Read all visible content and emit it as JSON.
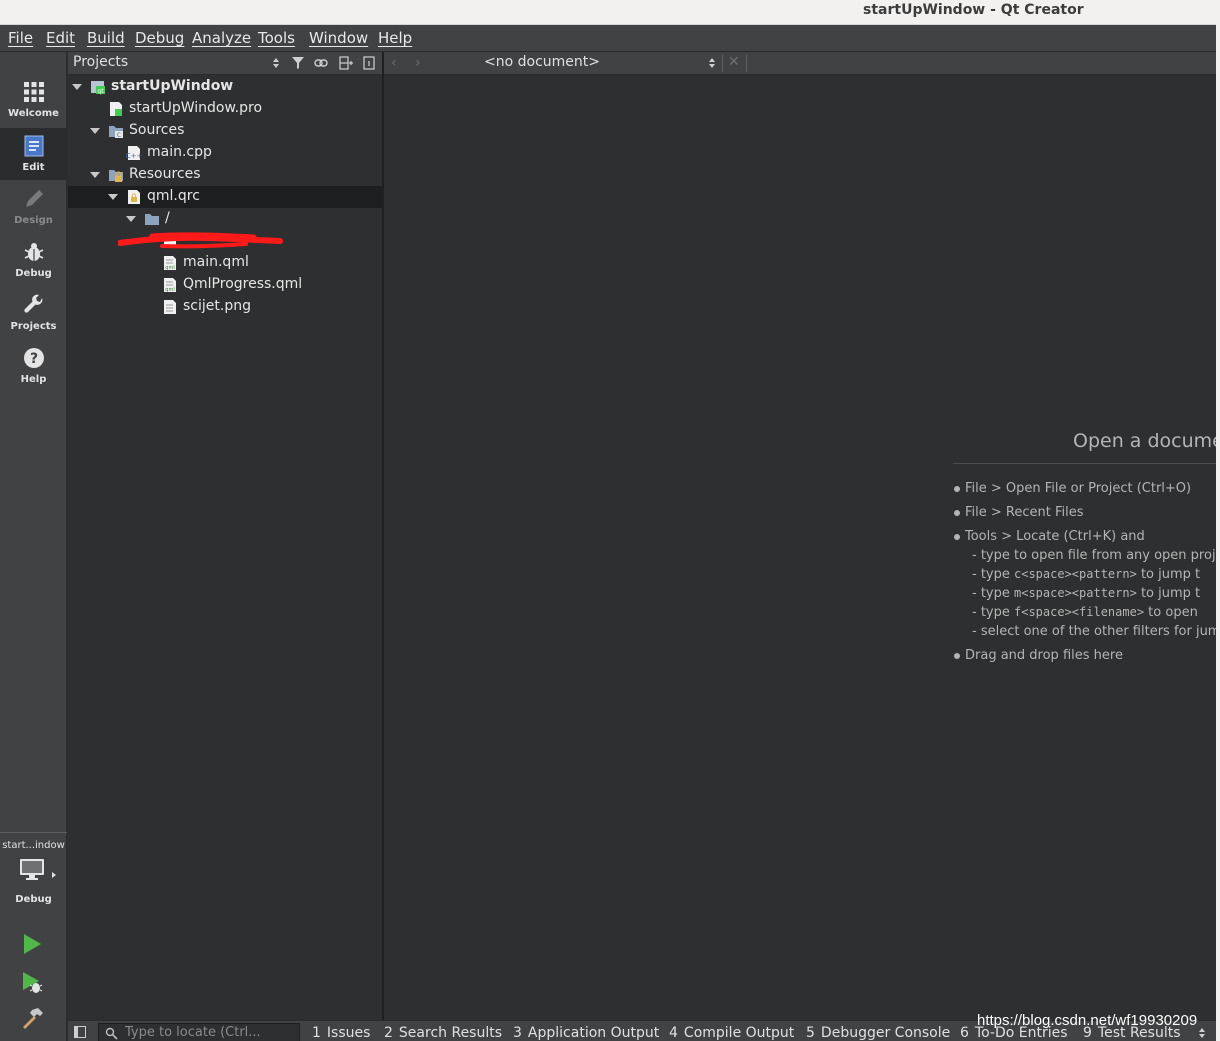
{
  "window": {
    "title": "startUpWindow - Qt Creator"
  },
  "menu": [
    "File",
    "Edit",
    "Build",
    "Debug",
    "Analyze",
    "Tools",
    "Window",
    "Help"
  ],
  "modes": [
    {
      "label": "Welcome",
      "icon": "grid-icon",
      "state": "normal"
    },
    {
      "label": "Edit",
      "icon": "document-icon",
      "state": "active"
    },
    {
      "label": "Design",
      "icon": "pencil-icon",
      "state": "disabled"
    },
    {
      "label": "Debug",
      "icon": "bug-icon",
      "state": "normal"
    },
    {
      "label": "Projects",
      "icon": "wrench-icon",
      "state": "normal"
    },
    {
      "label": "Help",
      "icon": "question-icon",
      "state": "normal"
    }
  ],
  "kit": {
    "name": "start...indow",
    "build_config": "Debug",
    "icon": "monitor-icon"
  },
  "run_controls": {
    "run_icon": "run-icon",
    "debug_run_icon": "debug-run-icon",
    "build_icon": "hammer-icon"
  },
  "projects_pane": {
    "title": "Projects",
    "toolbar_icons": [
      "filter-icon",
      "link-icon",
      "split-icon",
      "close-pane-icon"
    ],
    "tree": [
      {
        "label": "startUpWindow",
        "bold": true,
        "expanded": true,
        "icon": "qt-project-icon"
      },
      {
        "label": "startUpWindow.pro",
        "icon": "pro-file-icon"
      },
      {
        "label": "Sources",
        "expanded": true,
        "icon": "sources-folder-icon"
      },
      {
        "label": "main.cpp",
        "icon": "cpp-file-icon"
      },
      {
        "label": "Resources",
        "expanded": true,
        "icon": "resources-folder-icon"
      },
      {
        "label": "qml.qrc",
        "expanded": true,
        "icon": "qrc-file-icon",
        "selected": true
      },
      {
        "label": "/",
        "expanded": true,
        "icon": "folder-icon"
      },
      {
        "label": "",
        "icon": "image-file-icon",
        "redacted": true
      },
      {
        "label": "main.qml",
        "icon": "qml-file-icon"
      },
      {
        "label": "QmlProgress.qml",
        "icon": "qml-file-icon"
      },
      {
        "label": "scijet.png",
        "icon": "image-file-icon"
      }
    ]
  },
  "editor": {
    "document_selector": "<no document>",
    "open_heading": "Open a documer",
    "hints": [
      {
        "bullet": true,
        "text": "File > Open File or Project (Ctrl+O)"
      },
      {
        "bullet": true,
        "text": "File > Recent Files"
      },
      {
        "bullet": true,
        "text": "Tools > Locate (Ctrl+K) and"
      },
      {
        "bullet": false,
        "prefix": "- type to open file from any open projec",
        "mono": "",
        "suffix": ""
      },
      {
        "bullet": false,
        "prefix": "- type ",
        "mono": "c<space><pattern>",
        "suffix": " to jump t"
      },
      {
        "bullet": false,
        "prefix": "- type ",
        "mono": "m<space><pattern>",
        "suffix": " to jump t"
      },
      {
        "bullet": false,
        "prefix": "- type ",
        "mono": "f<space><filename>",
        "suffix": " to open"
      },
      {
        "bullet": false,
        "prefix": "- select one of the other filters for jump",
        "mono": "",
        "suffix": ""
      },
      {
        "bullet": true,
        "text": "Drag and drop files here"
      }
    ]
  },
  "bottom_bar": {
    "locator_placeholder": "Type to locate (Ctrl...",
    "tabs": [
      {
        "num": "1",
        "label": "Issues"
      },
      {
        "num": "2",
        "label": "Search Results"
      },
      {
        "num": "3",
        "label": "Application Output"
      },
      {
        "num": "4",
        "label": "Compile Output"
      },
      {
        "num": "5",
        "label": "Debugger Console"
      },
      {
        "num": "6",
        "label": "To-Do Entries"
      },
      {
        "num": "9",
        "label": "Test Results"
      }
    ]
  },
  "watermark": "https://blog.csdn.net/wf19930209",
  "colors": {
    "panel": "#404244",
    "background": "#2e2f30",
    "run_green": "#4fb847"
  }
}
